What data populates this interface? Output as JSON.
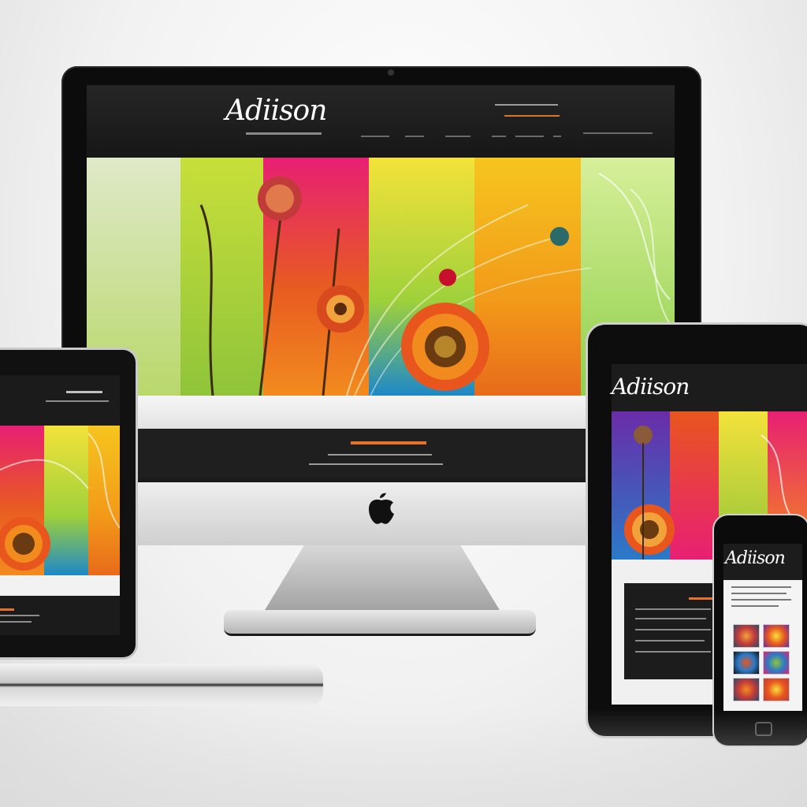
{
  "scene": {
    "devices": [
      "desktop-monitor",
      "tablet-left",
      "keyboard",
      "tablet-right",
      "smartphone"
    ]
  },
  "brand": {
    "logo_desktop": "Adiison",
    "logo_tablet": "Adiison",
    "logo_phone": "Adiison"
  },
  "colors": {
    "accent_orange": "#e8702a",
    "header_dark": "#1c1c1c",
    "art_magenta": "#e81f74",
    "art_yellow": "#f4e23a",
    "art_green": "#8fc43a"
  },
  "icons": {
    "apple": "apple-logo-icon",
    "sunflower": "sunflower-art"
  }
}
